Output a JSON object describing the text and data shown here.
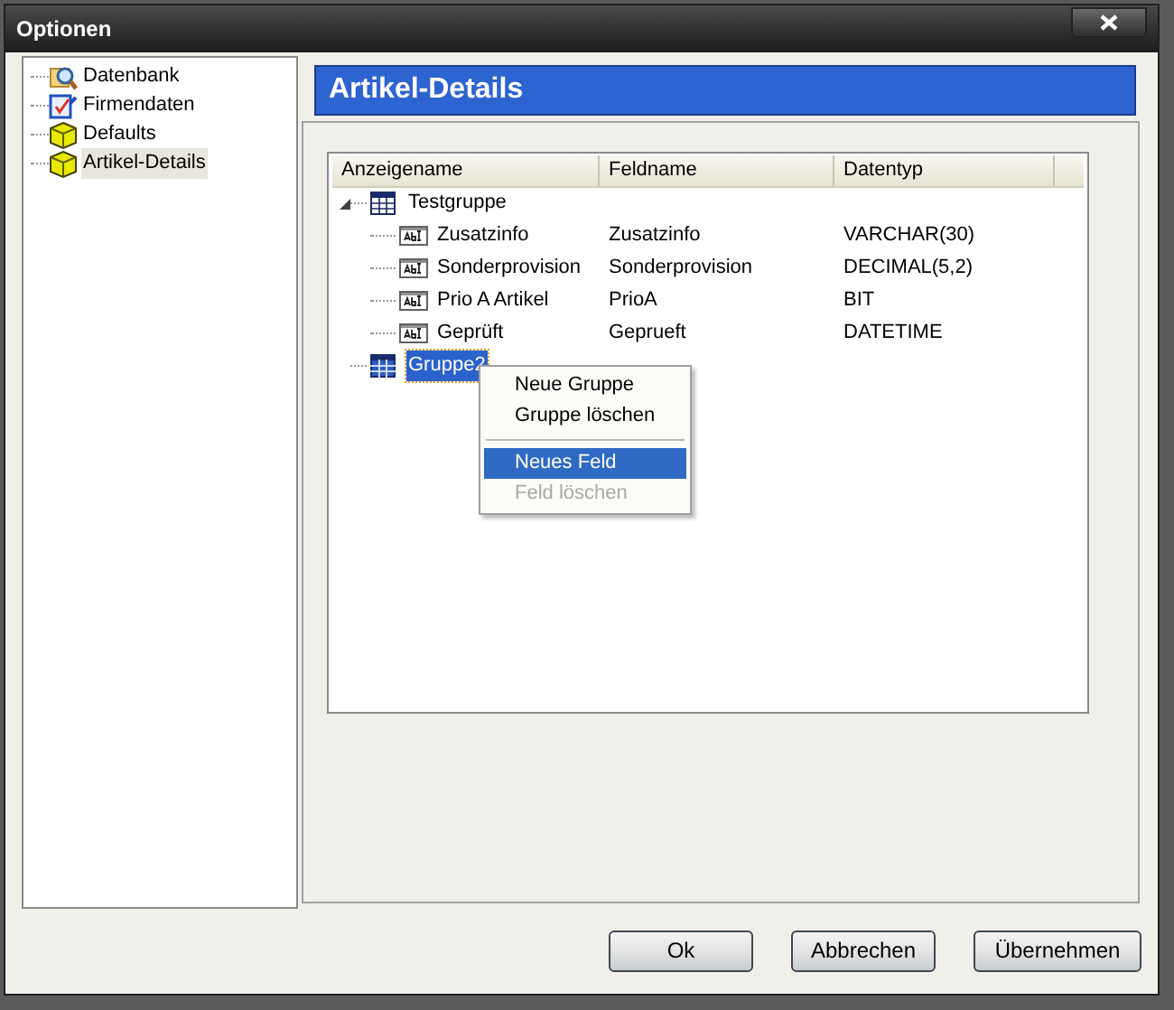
{
  "window": {
    "title": "Optionen"
  },
  "sidebar": {
    "items": [
      {
        "label": "Datenbank",
        "kind": "database",
        "selected": false
      },
      {
        "label": "Firmendaten",
        "kind": "form",
        "selected": false
      },
      {
        "label": "Defaults",
        "kind": "cube",
        "selected": false
      },
      {
        "label": "Artikel-Details",
        "kind": "cube",
        "selected": true
      }
    ]
  },
  "header": "Artikel-Details",
  "table": {
    "columns": [
      "Anzeigename",
      "Feldname",
      "Datentyp"
    ],
    "groups": [
      {
        "name": "Testgruppe",
        "expanded": true,
        "selected": false,
        "children": [
          {
            "name": "Zusatzinfo",
            "field": "Zusatzinfo",
            "type": "VARCHAR(30)"
          },
          {
            "name": "Sonderprovision",
            "field": "Sonderprovision",
            "type": "DECIMAL(5,2)"
          },
          {
            "name": "Prio A Artikel",
            "field": "PrioA",
            "type": "BIT"
          },
          {
            "name": "Geprüft",
            "field": "Geprueft",
            "type": "DATETIME"
          }
        ]
      },
      {
        "name": "Gruppe2",
        "selected": true
      }
    ]
  },
  "context_menu": {
    "items": [
      {
        "label": "Neue Gruppe",
        "selected": false,
        "disabled": false
      },
      {
        "label": "Gruppe löschen",
        "selected": false,
        "disabled": false
      },
      {
        "kind": "separator"
      },
      {
        "label": "Neues Feld",
        "selected": true,
        "disabled": false
      },
      {
        "label": "Feld löschen",
        "selected": false,
        "disabled": true
      }
    ]
  },
  "buttons": [
    {
      "label": "Ok"
    },
    {
      "label": "Abbrechen"
    },
    {
      "label": "Übernehmen"
    }
  ]
}
